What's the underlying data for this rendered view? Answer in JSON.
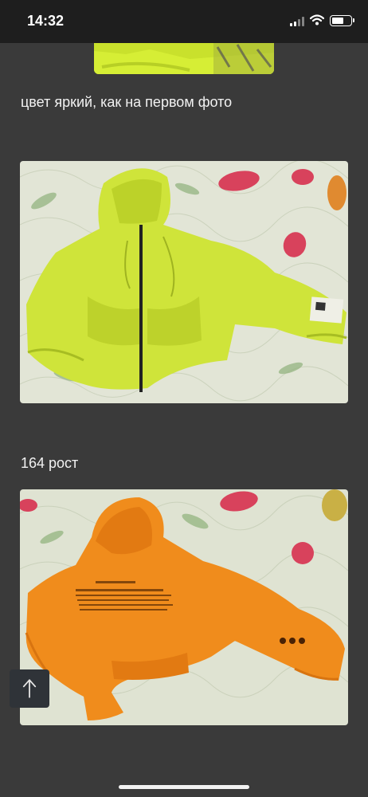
{
  "status": {
    "time": "14:32"
  },
  "post": {
    "caption_1": "цвет яркий, как на первом фото",
    "caption_2": "164 рост"
  },
  "colors": {
    "background": "#3a3a3a",
    "status_bar": "#1e1e1e",
    "neon_hoodie": "#d3ea35",
    "orange_hoodie": "#f18a1e",
    "bedspread": "#dfe3d2"
  },
  "icons": {
    "scroll_top": "arrow-up-icon",
    "signal": "signal-icon",
    "wifi": "wifi-icon",
    "battery": "battery-icon"
  }
}
